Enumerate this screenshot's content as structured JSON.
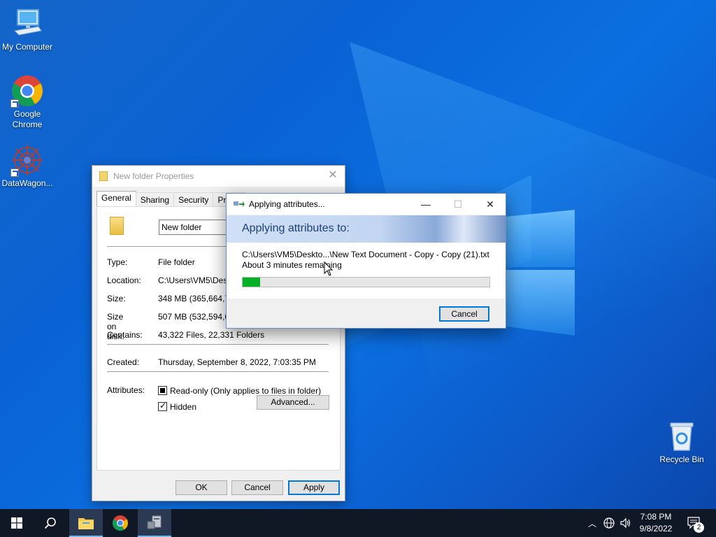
{
  "desktop": {
    "icons": [
      {
        "label": "My Computer"
      },
      {
        "label": "Google Chrome"
      },
      {
        "label": "DataWagon..."
      },
      {
        "label": "Recycle Bin"
      }
    ]
  },
  "properties": {
    "title": "New folder Properties",
    "tabs": [
      "General",
      "Sharing",
      "Security",
      "Previo"
    ],
    "name_value": "New folder",
    "fields": [
      {
        "label": "Type:",
        "value": "File folder"
      },
      {
        "label": "Location:",
        "value": "C:\\Users\\VM5\\Desk"
      },
      {
        "label": "Size:",
        "value": "348 MB (365,664,78"
      },
      {
        "label": "Size on disk:",
        "value": "507 MB (532,594,68"
      },
      {
        "label": "Contains:",
        "value": "43,322 Files, 22,331 Folders"
      },
      {
        "label": "Created:",
        "value": "Thursday, September 8, 2022, 7:03:35 PM"
      }
    ],
    "attributes_label": "Attributes:",
    "readonly_label": "Read-only (Only applies to files in folder)",
    "hidden_label": "Hidden",
    "advanced_button": "Advanced...",
    "ok_button": "OK",
    "cancel_button": "Cancel",
    "apply_button": "Apply"
  },
  "dialog": {
    "title": "Applying attributes...",
    "heading": "Applying attributes to:",
    "path": "C:\\Users\\VM5\\Deskto...\\New Text Document - Copy - Copy (21).txt",
    "remaining": "About 3 minutes remaining",
    "progress_percent": 7,
    "cancel_button": "Cancel",
    "colors": {
      "progress": "#06b025"
    }
  },
  "taskbar": {
    "time": "7:08 PM",
    "date": "9/8/2022",
    "notification_count": "2"
  }
}
